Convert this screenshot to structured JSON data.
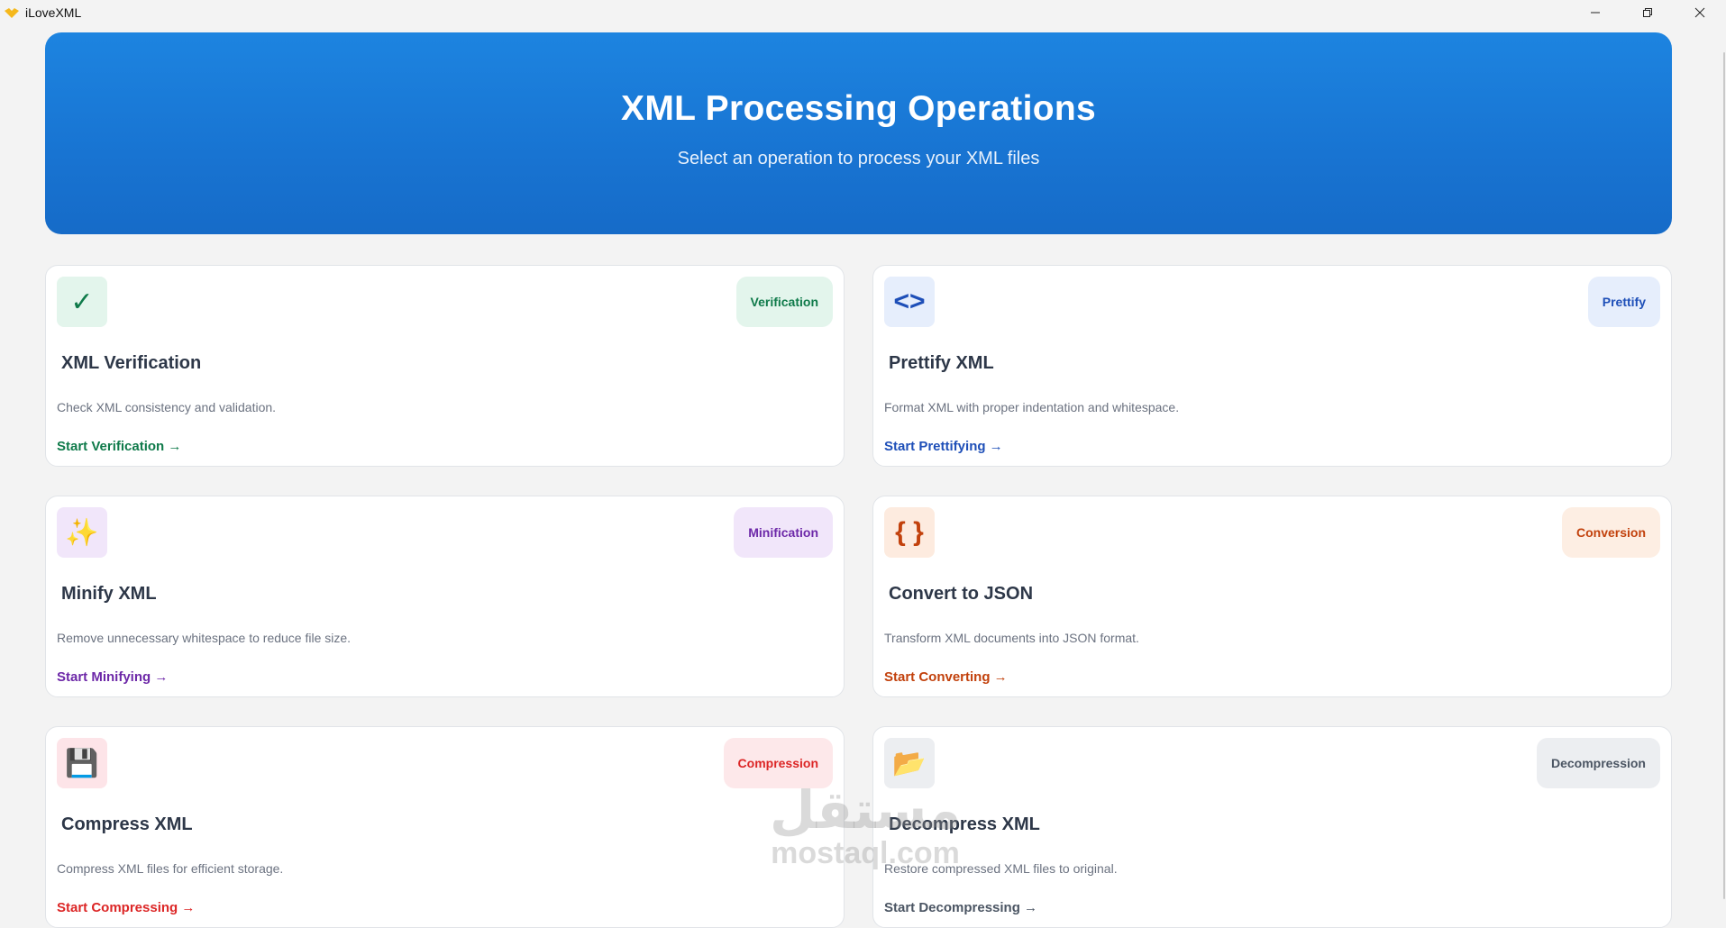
{
  "window": {
    "title": "iLoveXML",
    "logo_icon": "heart-hand-icon",
    "controls": [
      "minimize",
      "restore",
      "close"
    ]
  },
  "hero": {
    "title": "XML Processing Operations",
    "subtitle": "Select an operation to process your XML files"
  },
  "cards": [
    {
      "icon": "checkmark-icon",
      "icon_glyph": "✓",
      "badge": "Verification",
      "title": "XML Verification",
      "description": "Check XML consistency and validation.",
      "link": "Start Verification →",
      "accent": "#0f7a4a",
      "icon_bg": "#e3f5ec",
      "badge_bg": "#e3f5ec"
    },
    {
      "icon": "code-brackets-icon",
      "icon_glyph": "<>",
      "badge": "Prettify",
      "title": "Prettify XML",
      "description": "Format XML with proper indentation and whitespace.",
      "link": "Start Prettifying →",
      "accent": "#1e4fb8",
      "icon_bg": "#e6eefc",
      "badge_bg": "#e6eefc"
    },
    {
      "icon": "sparkles-icon",
      "icon_glyph": "✨",
      "badge": "Minification",
      "title": "Minify XML",
      "description": "Remove unnecessary whitespace to reduce file size.",
      "link": "Start Minifying →",
      "accent": "#6d28a8",
      "icon_bg": "#f1e6fa",
      "badge_bg": "#f1e6fa"
    },
    {
      "icon": "curly-braces-icon",
      "icon_glyph": "{ }",
      "badge": "Conversion",
      "title": "Convert to JSON",
      "description": "Transform XML documents into JSON format.",
      "link": "Start Converting →",
      "accent": "#c2410c",
      "icon_bg": "#fdebdf",
      "badge_bg": "#fdeee3"
    },
    {
      "icon": "floppy-disk-icon",
      "icon_glyph": "💾",
      "badge": "Compression",
      "title": "Compress XML",
      "description": "Compress XML files for efficient storage.",
      "link": "Start Compressing →",
      "accent": "#dc2626",
      "icon_bg": "#fde4e8",
      "badge_bg": "#fde8ea"
    },
    {
      "icon": "folder-icon",
      "icon_glyph": "📂",
      "badge": "Decompression",
      "title": "Decompress XML",
      "description": "Restore compressed XML files to original.",
      "link": "Start Decompressing →",
      "accent": "#4b5563",
      "icon_bg": "#eceef1",
      "badge_bg": "#eceef1"
    }
  ],
  "watermark": {
    "arabic": "مستقل",
    "latin": "mostaql.com"
  }
}
